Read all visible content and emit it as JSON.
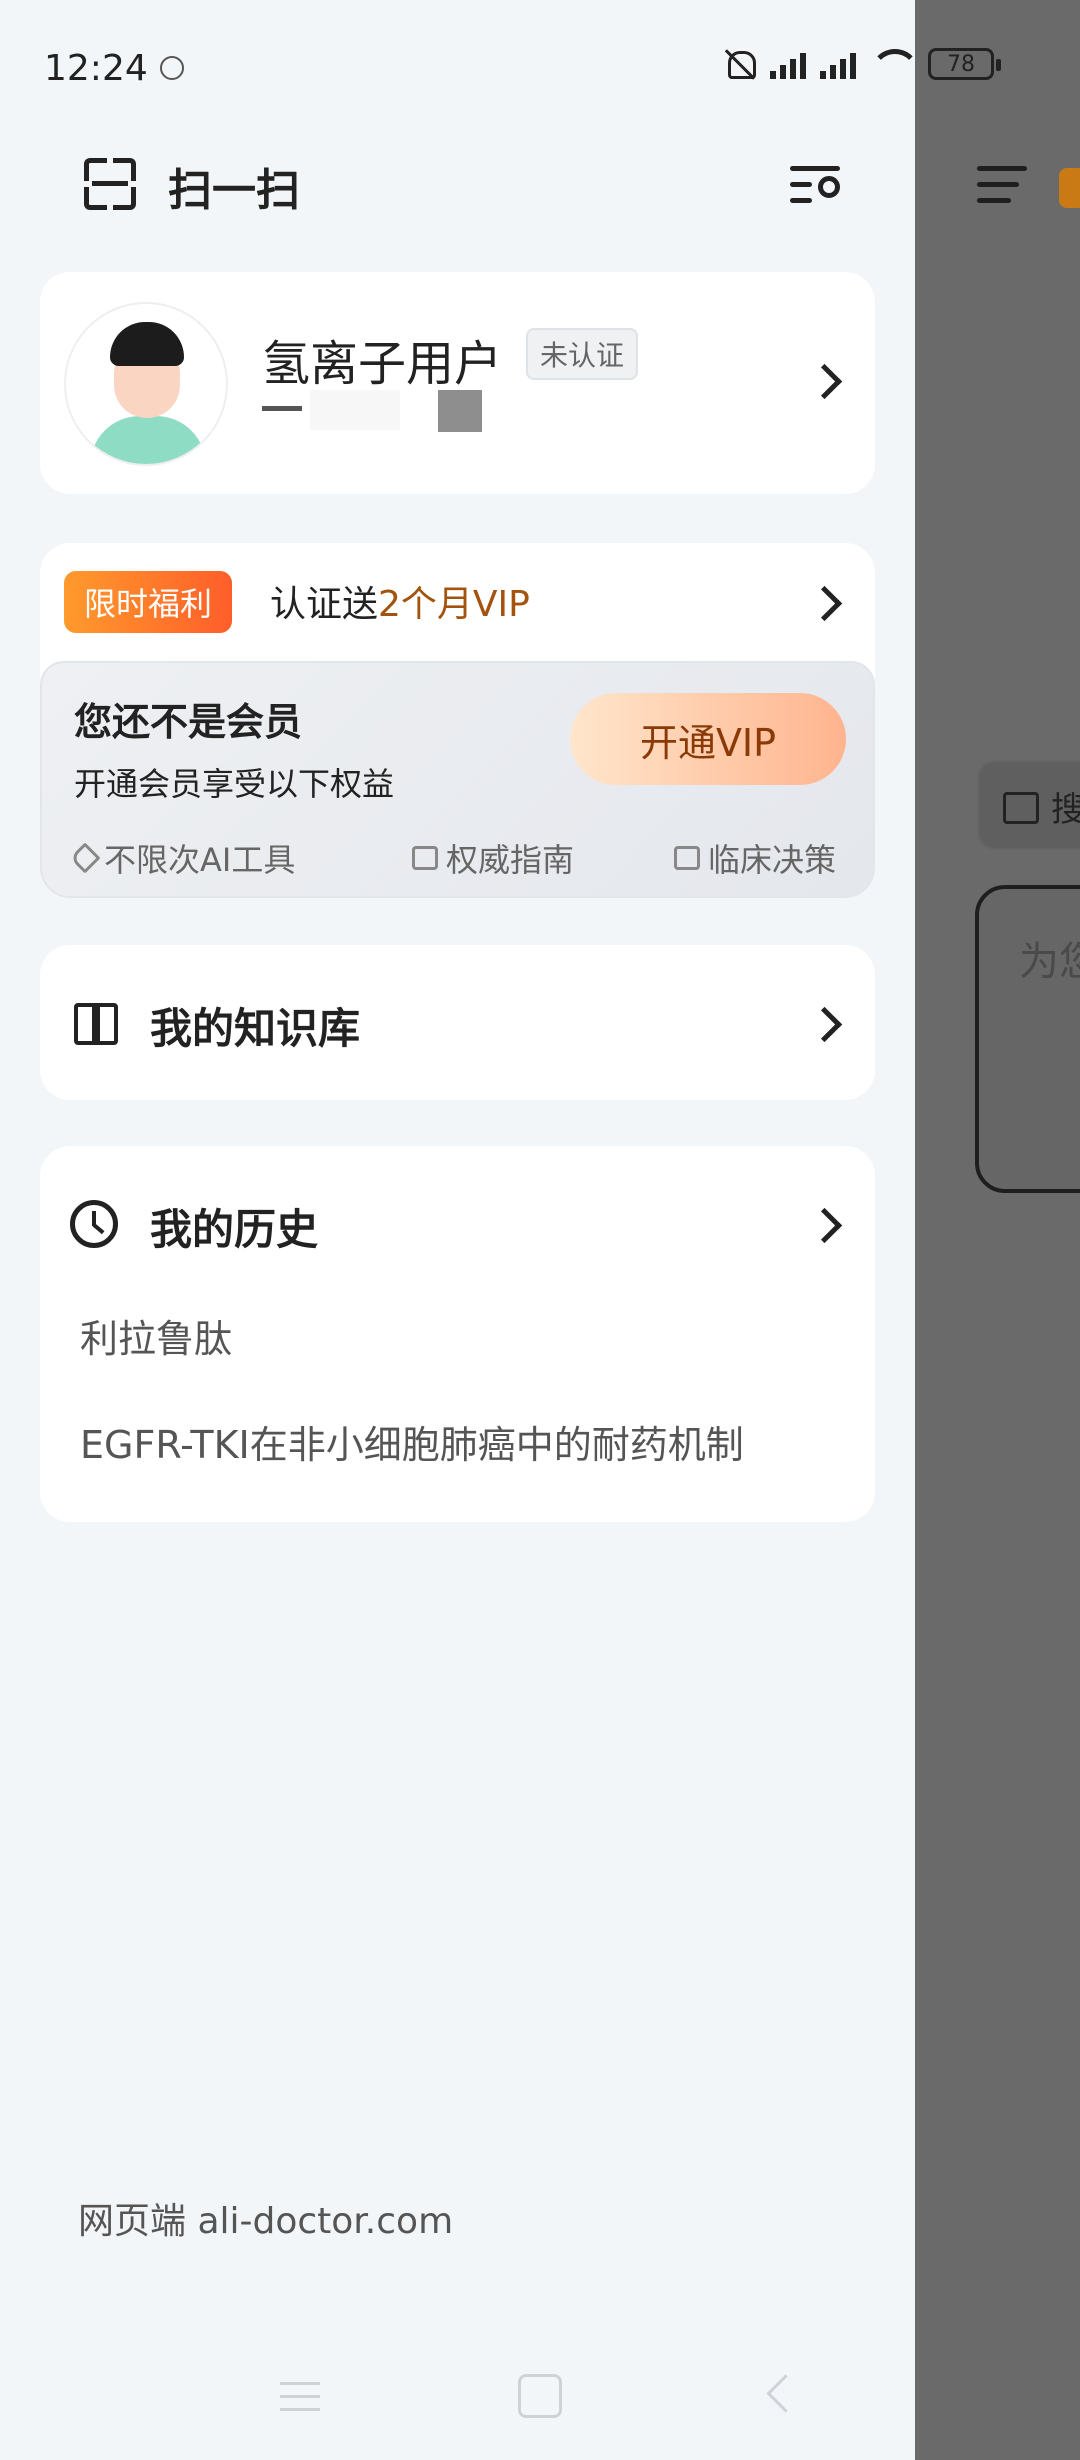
{
  "status_bar": {
    "time": "12:24",
    "battery": "78"
  },
  "top_bar": {
    "scan_label": "扫一扫"
  },
  "profile": {
    "name": "氢离子用户",
    "verify_status": "未认证"
  },
  "promo": {
    "badge": "限时福利",
    "text_prefix": "认证送",
    "text_highlight": "2个月VIP"
  },
  "vip": {
    "title": "您还不是会员",
    "subtitle": "开通会员享受以下权益",
    "button_label": "开通VIP",
    "benefits": [
      {
        "label": "不限次AI工具",
        "icon": "diamond-icon"
      },
      {
        "label": "权威指南",
        "icon": "book-icon"
      },
      {
        "label": "临床决策",
        "icon": "decision-icon"
      }
    ]
  },
  "knowledge": {
    "label": "我的知识库"
  },
  "history": {
    "title": "我的历史",
    "items": [
      "利拉鲁肽",
      "EGFR-TKI在非小细胞肺癌中的耐药机制"
    ]
  },
  "footer": {
    "text": "网页端 ali-doctor.com"
  },
  "underlying": {
    "search_chip": "搜",
    "chat_placeholder": "为您"
  },
  "colors": {
    "promo_badge": "#ff6a2a",
    "vip_highlight": "#a4530f",
    "vip_button": "#ffb48e"
  }
}
